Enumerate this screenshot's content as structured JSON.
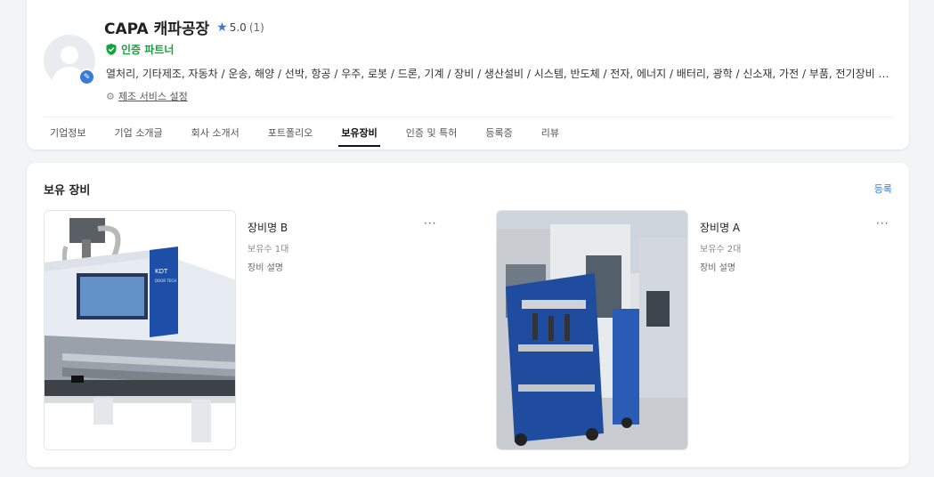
{
  "company": {
    "name": "CAPA 캐파공장",
    "rating": "5.0",
    "review_count": "(1)",
    "certification": "인증 파트너",
    "categories": "열처리, 기타제조, 자동차 / 운송, 해양 / 선박, 항공 / 우주, 로봇 / 드론, 기계 / 장비 / 생산설비 / 시스템, 반도체 / 전자, 에너지 / 배터리, 광학 / 신소재, 가전 / 부품, 전기장비 / 부품, 국...",
    "settings_link": "제조 서비스 설정"
  },
  "tabs": [
    {
      "label": "기업정보"
    },
    {
      "label": "기업 소개글"
    },
    {
      "label": "회사 소개서"
    },
    {
      "label": "포트폴리오"
    },
    {
      "label": "보유장비",
      "active": true
    },
    {
      "label": "인증 및 특허"
    },
    {
      "label": "등록증"
    },
    {
      "label": "리뷰"
    }
  ],
  "equipment": {
    "title": "보유 장비",
    "register_label": "등록",
    "more_label": "···",
    "items": [
      {
        "name": "장비명 B",
        "quantity": "보유수 1대",
        "description": "장비 설명",
        "image": "cnc-machine-photo"
      },
      {
        "name": "장비명 A",
        "quantity": "보유수 2대",
        "description": "장비 설명",
        "image": "tool-cart-factory-photo"
      }
    ]
  },
  "colors": {
    "accent": "#3a7bd5",
    "certified": "#14a33d",
    "background": "#f3f4f6"
  }
}
